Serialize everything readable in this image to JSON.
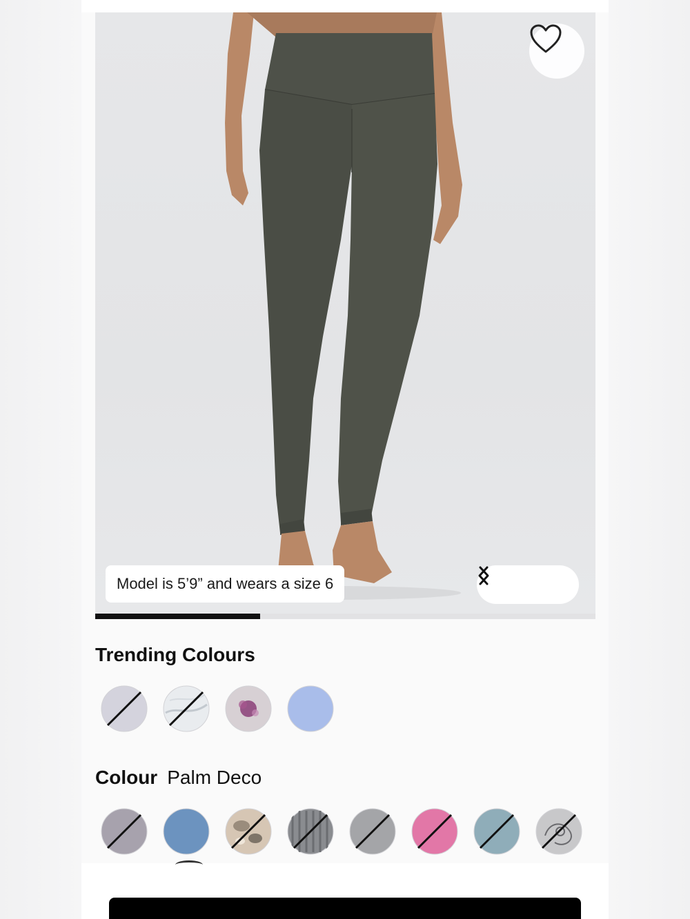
{
  "product_image": {
    "alt": "",
    "model_note": "Model is 5’9” and wears a size 6",
    "gallery_progress": 0.33
  },
  "icons": {
    "favorite": "heart-outline-icon",
    "prev": "chevron-left-icon",
    "next": "chevron-right-icon"
  },
  "trending": {
    "title": "Trending Colours",
    "swatches": [
      {
        "color": "#d4d3dd",
        "pattern": "solid",
        "unavailable": true
      },
      {
        "color": "#e9ecef",
        "pattern": "marble",
        "unavailable": true
      },
      {
        "color": "#d7d0d4",
        "pattern": "floral",
        "unavailable": false
      },
      {
        "color": "#a9bdea",
        "pattern": "solid",
        "unavailable": false
      }
    ]
  },
  "colour": {
    "label": "Colour",
    "selected": "Palm Deco",
    "swatches": [
      {
        "color": "#a7a2ad",
        "pattern": "solid",
        "unavailable": true
      },
      {
        "color": "#6c93bf",
        "pattern": "solid",
        "unavailable": false
      },
      {
        "color": "#d6c6b4",
        "pattern": "camo",
        "unavailable": true
      },
      {
        "color": "#8a8c90",
        "pattern": "stripe",
        "unavailable": true
      },
      {
        "color": "#a4a5a8",
        "pattern": "solid",
        "unavailable": true
      },
      {
        "color": "#e277a7",
        "pattern": "solid",
        "unavailable": true
      },
      {
        "color": "#8fadb9",
        "pattern": "solid",
        "unavailable": true
      },
      {
        "color": "#c8c8ca",
        "pattern": "lace",
        "unavailable": true
      }
    ]
  },
  "colors": {
    "legging": "#4a4d45",
    "skin": "#b98867",
    "progress": "#111111",
    "cta": "#000000"
  }
}
